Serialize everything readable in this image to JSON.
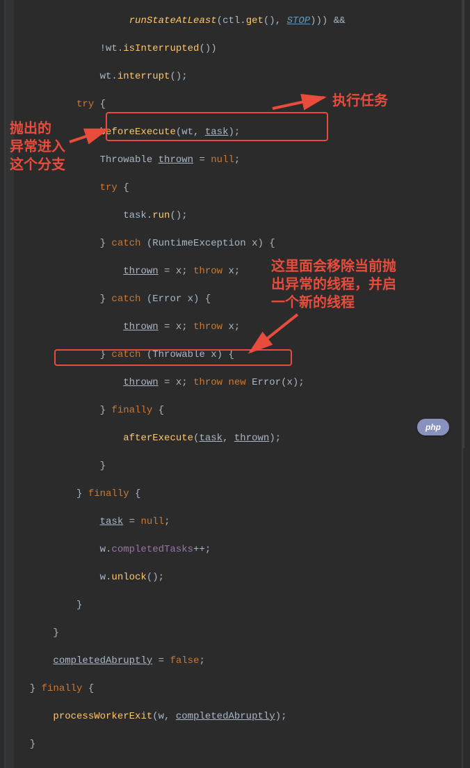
{
  "code": {
    "l1a": "                   ",
    "l1b": "runStateAtLeast",
    "l1c": "(ctl.",
    "l1d": "get",
    "l1e": "(), ",
    "l1f": "STOP",
    "l1g": "))) &&",
    "l2a": "              !wt.",
    "l2b": "isInterrupted",
    "l2c": "())",
    "l3a": "              wt.",
    "l3b": "interrupt",
    "l3c": "();",
    "l4a": "          try",
    "l4b": " {",
    "l5a": "              ",
    "l5b": "beforeExecute",
    "l5c": "(wt, ",
    "l5d": "task",
    "l5e": ");",
    "l6a": "              Throwable ",
    "l6b": "thrown",
    "l6c": " = ",
    "l6d": "null",
    "l6e": ";",
    "l7a": "              try",
    "l7b": " {",
    "l8a": "                  task.",
    "l8b": "run",
    "l8c": "();",
    "l9a": "              } ",
    "l9b": "catch",
    "l9c": " (RuntimeException x) {",
    "l10a": "                  ",
    "l10b": "thrown",
    "l10c": " = x; ",
    "l10d": "throw",
    "l10e": " x;",
    "l11a": "              } ",
    "l11b": "catch",
    "l11c": " (Error x) {",
    "l12a": "                  ",
    "l12b": "thrown",
    "l12c": " = x; ",
    "l12d": "throw",
    "l12e": " x;",
    "l13a": "              } ",
    "l13b": "catch",
    "l13c": " (Throwable x) {",
    "l14a": "                  ",
    "l14b": "thrown",
    "l14c": " = x; ",
    "l14d": "throw new",
    "l14e": " Error(x);",
    "l15a": "              } ",
    "l15b": "finally",
    "l15c": " {",
    "l16a": "                  ",
    "l16b": "afterExecute",
    "l16c": "(",
    "l16d": "task",
    "l16e": ", ",
    "l16f": "thrown",
    "l16g": ");",
    "l17": "              }",
    "l18a": "          } ",
    "l18b": "finally",
    "l18c": " {",
    "l19a": "              ",
    "l19b": "task",
    "l19c": " = ",
    "l19d": "null",
    "l19e": ";",
    "l20a": "              w.",
    "l20b": "completedTasks",
    "l20c": "++;",
    "l21a": "              w.",
    "l21b": "unlock",
    "l21c": "();",
    "l22": "          }",
    "l23": "      }",
    "l24a": "      ",
    "l24b": "completedAbruptly",
    "l24c": " = ",
    "l24d": "false",
    "l24e": ";",
    "l25a": "  } ",
    "l25b": "finally",
    "l25c": " {",
    "l26a": "      ",
    "l26b": "processWorkerExit",
    "l26c": "(w, ",
    "l26d": "completedAbruptly",
    "l26e": ");",
    "l27": "  }"
  },
  "annotations": {
    "exec_task": "执行任务",
    "exception_branch": "抛出的\n异常进入\n这个分支",
    "remove_thread": "这里面会移除当前抛\n出异常的线程，并启\n一个新的线程"
  },
  "badge": "php"
}
